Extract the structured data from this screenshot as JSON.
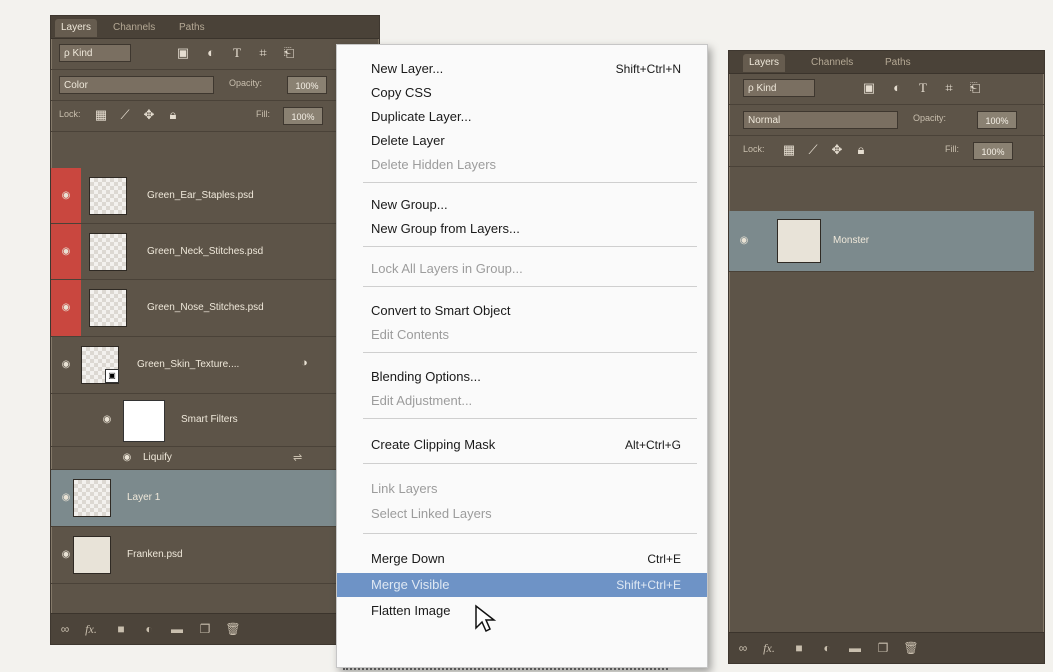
{
  "left_panel": {
    "tabs": [
      "Layers",
      "Channels",
      "Paths"
    ],
    "kind_label": "ρ Kind",
    "blend_mode": "Color",
    "opacity_label": "Opacity:",
    "opacity_value": "100%",
    "lock_label": "Lock:",
    "fill_label": "Fill:",
    "fill_value": "100%",
    "layers": [
      {
        "name": "Green_Ear_Staples.psd"
      },
      {
        "name": "Green_Neck_Stitches.psd"
      },
      {
        "name": "Green_Nose_Stitches.psd"
      },
      {
        "name": "Green_Skin_Texture...."
      },
      {
        "name": "Smart Filters"
      },
      {
        "name": "Liquify"
      },
      {
        "name": "Layer 1"
      },
      {
        "name": "Franken.psd"
      }
    ]
  },
  "context_menu": {
    "items": [
      {
        "label": "New Layer...",
        "shortcut": "Shift+Ctrl+N"
      },
      {
        "label": "Copy CSS",
        "shortcut": ""
      },
      {
        "label": "Duplicate Layer...",
        "shortcut": ""
      },
      {
        "label": "Delete Layer",
        "shortcut": ""
      },
      {
        "label": "Delete Hidden Layers",
        "shortcut": ""
      },
      {
        "label": "New Group...",
        "shortcut": ""
      },
      {
        "label": "New Group from Layers...",
        "shortcut": ""
      },
      {
        "label": "Lock All Layers in Group...",
        "shortcut": ""
      },
      {
        "label": "Convert to Smart Object",
        "shortcut": ""
      },
      {
        "label": "Edit Contents",
        "shortcut": ""
      },
      {
        "label": "Blending Options...",
        "shortcut": ""
      },
      {
        "label": "Edit Adjustment...",
        "shortcut": ""
      },
      {
        "label": "Create Clipping Mask",
        "shortcut": "Alt+Ctrl+G"
      },
      {
        "label": "Link Layers",
        "shortcut": ""
      },
      {
        "label": "Select Linked Layers",
        "shortcut": ""
      },
      {
        "label": "Merge Down",
        "shortcut": "Ctrl+E"
      },
      {
        "label": "Merge Visible",
        "shortcut": "Shift+Ctrl+E"
      },
      {
        "label": "Flatten Image",
        "shortcut": ""
      }
    ]
  },
  "right_panel": {
    "tabs": [
      "Layers",
      "Channels",
      "Paths"
    ],
    "kind_label": "ρ Kind",
    "blend_mode": "Normal",
    "opacity_label": "Opacity:",
    "opacity_value": "100%",
    "lock_label": "Lock:",
    "fill_label": "Fill:",
    "fill_value": "100%",
    "layers": [
      {
        "name": "Monster"
      }
    ]
  },
  "icons": {
    "bottom_bar": [
      "link-icon",
      "fx-icon",
      "mask-icon",
      "adjustment-icon",
      "folder-icon",
      "new-layer-icon",
      "trash-icon"
    ]
  },
  "colors": {
    "panel": "#5d5448",
    "selected_layer": "#7c8a8d",
    "red_eye_col": "#c9473f",
    "menu_highlight": "#6e93c6"
  }
}
